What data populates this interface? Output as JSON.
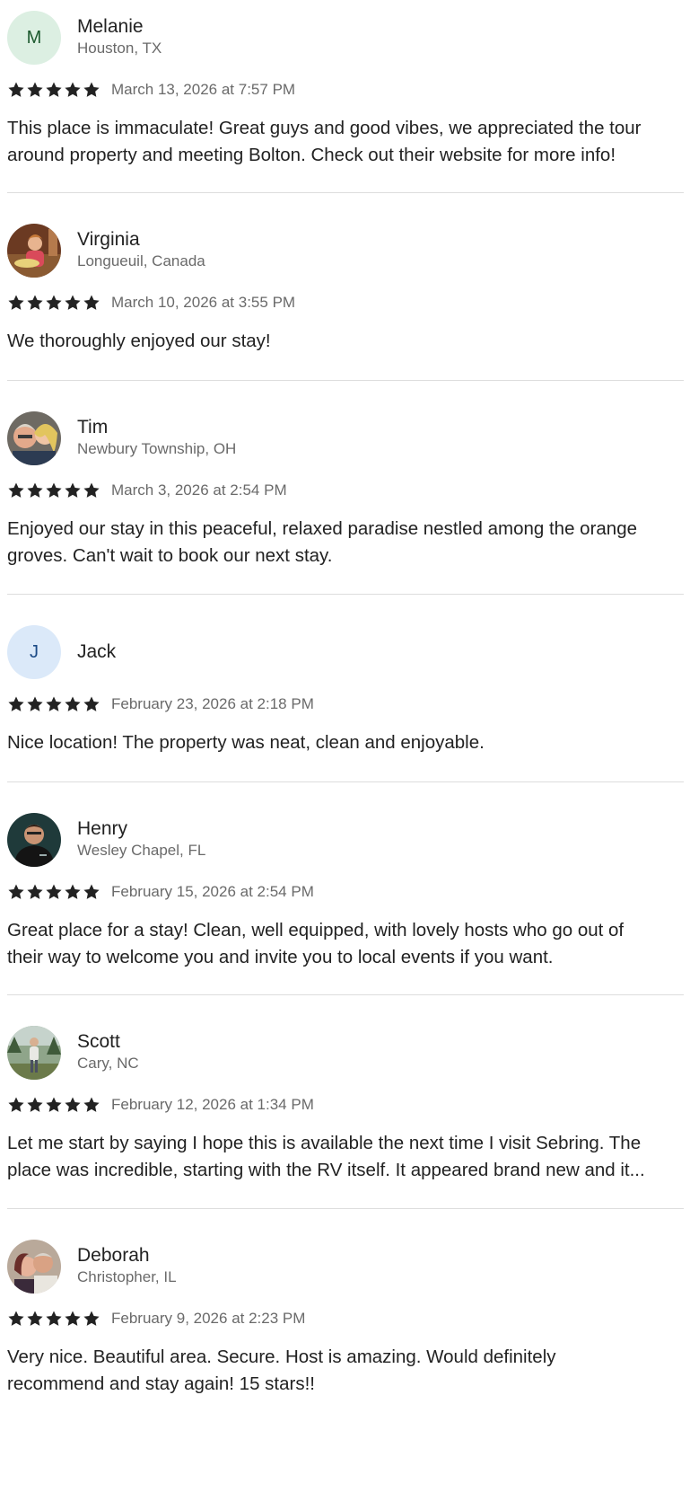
{
  "reviews": [
    {
      "name": "Melanie",
      "location": "Houston, TX",
      "avatar_initial": "M",
      "rating": 5,
      "date": "March 13, 2026 at 7:57 PM",
      "lines": [
        "This place is immaculate! Great guys and good vibes, we appreciated the tour",
        "around property and meeting Bolton. Check out their website for more info!"
      ]
    },
    {
      "name": "Virginia",
      "location": "Longueuil, Canada",
      "rating": 5,
      "date": "March 10, 2026 at 3:55 PM",
      "lines": [
        "We thoroughly enjoyed our stay!"
      ]
    },
    {
      "name": "Tim",
      "location": "Newbury Township, OH",
      "rating": 5,
      "date": "March 3, 2026 at 2:54 PM",
      "lines": [
        "Enjoyed our stay in this peaceful, relaxed paradise nestled among the orange",
        "groves. Can't wait to book our next stay."
      ]
    },
    {
      "name": "Jack",
      "location": "",
      "avatar_initial": "J",
      "rating": 5,
      "date": "February 23, 2026 at 2:18 PM",
      "lines": [
        "Nice location! The property was neat, clean and enjoyable."
      ]
    },
    {
      "name": "Henry",
      "location": "Wesley Chapel, FL",
      "rating": 5,
      "date": "February 15, 2026 at 2:54 PM",
      "lines": [
        "Great place for a stay! Clean, well equipped, with lovely hosts who go out of",
        "their way to welcome you and invite you to local events if you want."
      ]
    },
    {
      "name": "Scott",
      "location": "Cary, NC",
      "rating": 5,
      "date": "February 12, 2026 at 1:34 PM",
      "lines": [
        "Let me start by saying I hope this is available the next time I visit Sebring. The",
        "place was incredible, starting with the RV itself. It appeared brand new and it..."
      ]
    },
    {
      "name": "Deborah",
      "location": "Christopher, IL",
      "rating": 5,
      "date": "February 9, 2026 at 2:23 PM",
      "lines": [
        "Very nice. Beautiful area. Secure. Host is amazing. Would definitely",
        "recommend and stay again! 15 stars!!"
      ]
    }
  ],
  "icons": {
    "star": "star-icon"
  },
  "colors": {
    "star": "#222222",
    "muted": "#6a6a6a",
    "divider": "#dddddd"
  }
}
